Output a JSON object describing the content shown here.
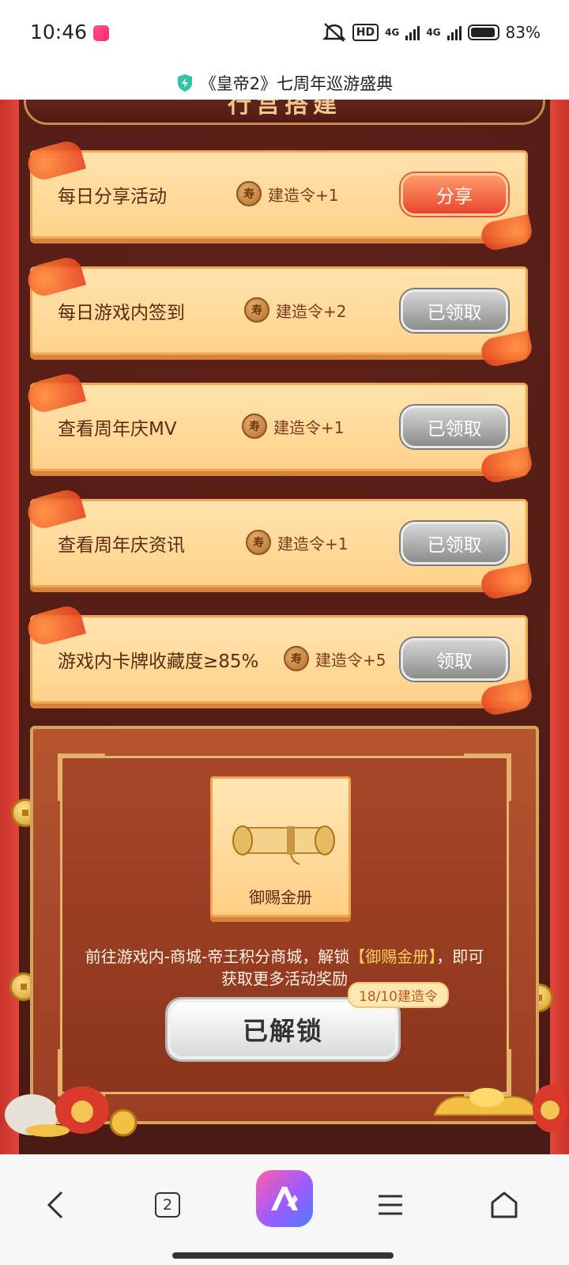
{
  "status_bar": {
    "time": "10:46",
    "network_badge": "HD",
    "network_1": "4G",
    "network_2": "4G",
    "battery": "83%"
  },
  "page": {
    "title": "《皇帝2》七周年巡游盛典",
    "section_header": "行宫搭建"
  },
  "tasks": [
    {
      "name": "每日分享活动",
      "reward": "建造令+1",
      "button": "分享",
      "state": "active"
    },
    {
      "name": "每日游戏内签到",
      "reward": "建造令+2",
      "button": "已领取",
      "state": "claimed"
    },
    {
      "name": "查看周年庆MV",
      "reward": "建造令+1",
      "button": "已领取",
      "state": "claimed"
    },
    {
      "name": "查看周年庆资讯",
      "reward": "建造令+1",
      "button": "已领取",
      "state": "claimed"
    },
    {
      "name": "游戏内卡牌收藏度≥85%",
      "reward": "建造令+5",
      "button": "领取",
      "state": "claimable"
    }
  ],
  "coin_char": "寿",
  "unlock": {
    "item_name": "御赐金册",
    "desc_prefix": "前往游戏内-商城-帝王积分商城，解锁",
    "desc_highlight": "【御赐金册】",
    "desc_suffix": "，即可",
    "desc_line2": "获取更多活动奖励",
    "progress": "18/10建造令",
    "button": "已解锁"
  },
  "nav": {
    "tab_count": "2"
  },
  "colors": {
    "accent_red": "#e8462e",
    "card_gold": "#ffd28a",
    "panel_brown": "#9a3d22",
    "highlight_yellow": "#ffcf5a"
  }
}
